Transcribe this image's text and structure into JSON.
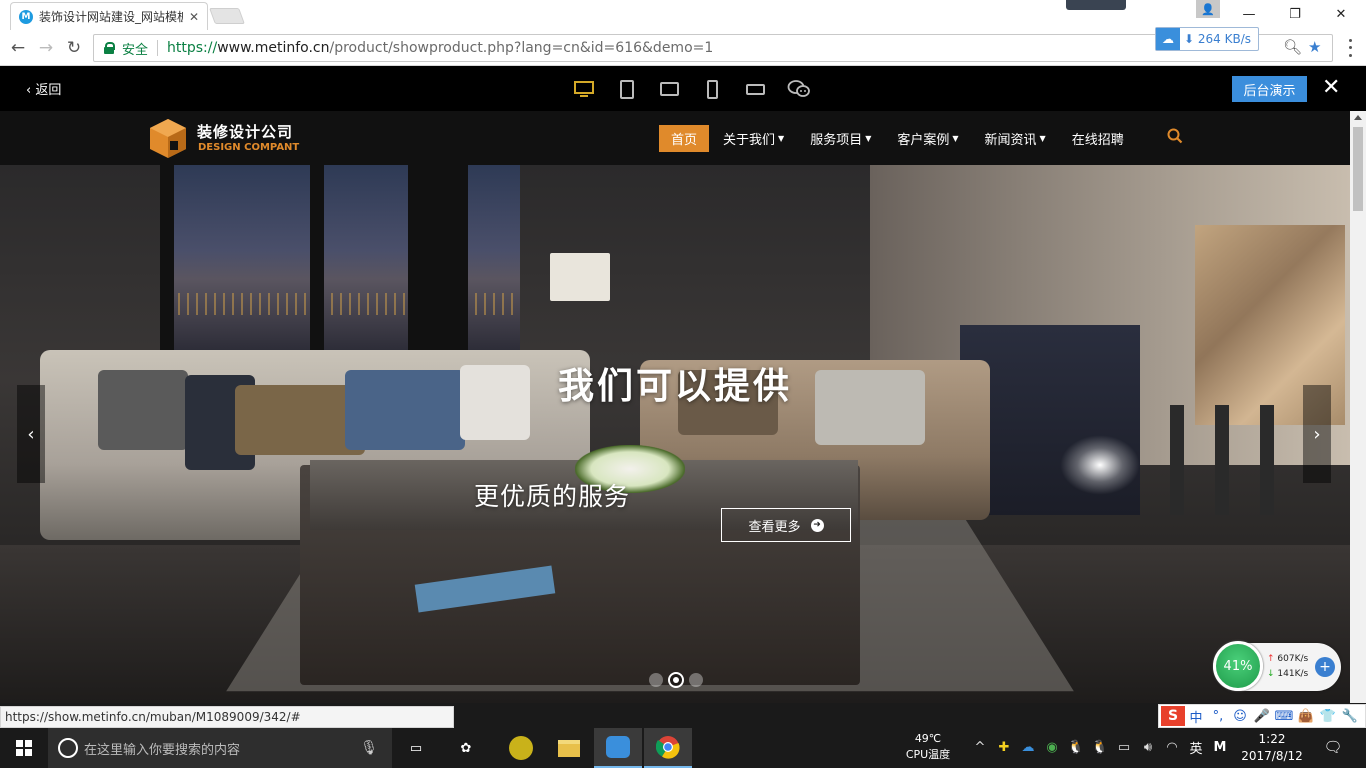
{
  "browser": {
    "tab_title": "装饰设计网站建设_网站模板",
    "tab_favicon": "M",
    "url_secure_label": "安全",
    "url_scheme": "https://",
    "url_host": "www.metinfo.cn",
    "url_path": "/product/showproduct.php?lang=cn&id=616&demo=1",
    "ext_speed": "264 KB/s",
    "status_url": "https://show.metinfo.cn/muban/M1089009/342/#"
  },
  "demobar": {
    "back_label": "返回",
    "devices": [
      "desktop-icon",
      "tablet-portrait-icon",
      "tablet-landscape-icon",
      "phone-portrait-icon",
      "phone-landscape-icon",
      "wechat-icon"
    ],
    "admin_label": "后台演示"
  },
  "site": {
    "logo_cn": "装修设计公司",
    "logo_en": "DESIGN COMPANT",
    "menu": [
      {
        "label": "首页",
        "active": true,
        "dropdown": false
      },
      {
        "label": "关于我们",
        "active": false,
        "dropdown": true
      },
      {
        "label": "服务项目",
        "active": false,
        "dropdown": true
      },
      {
        "label": "客户案例",
        "active": false,
        "dropdown": true
      },
      {
        "label": "新闻资讯",
        "active": false,
        "dropdown": true
      },
      {
        "label": "在线招聘",
        "active": false,
        "dropdown": false
      }
    ],
    "accent": "#e08a2b"
  },
  "banner": {
    "title": "我们可以提供",
    "subtitle": "更优质的服务",
    "button_label": "查看更多",
    "slides": 3,
    "active_slide": 2
  },
  "netwidget": {
    "percent": "41%",
    "up": "607K/s",
    "down": "141K/s"
  },
  "ime": {
    "items": [
      "中",
      "°,",
      "☺",
      "🎤",
      "⌨",
      "👜",
      "👕",
      "🔧"
    ]
  },
  "taskbar": {
    "search_placeholder": "在这里输入你要搜索的内容",
    "cpu_temp": "49℃",
    "cpu_label": "CPU温度",
    "lang": "英",
    "time": "1:22",
    "date": "2017/8/12"
  }
}
